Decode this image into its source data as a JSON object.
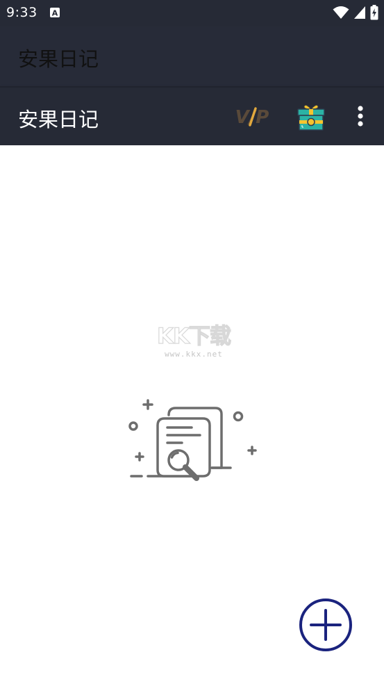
{
  "status_bar": {
    "time": "9:33",
    "notification_icon": "a-letter-icon",
    "icons": [
      "wifi-icon",
      "cell-signal-icon",
      "battery-charging-icon"
    ]
  },
  "title_bar": {
    "title": "安果日记"
  },
  "app_bar": {
    "title": "安果日记",
    "vip_label": "V/P",
    "vip_icon": "vip-icon",
    "gift_icon": "gift-box-icon",
    "menu_icon": "more-vert-icon"
  },
  "watermark": {
    "text": "KK下载",
    "url": "www.kkx.net"
  },
  "empty_state": {
    "icon": "document-search-icon"
  },
  "fab": {
    "icon": "plus-circle-icon"
  },
  "colors": {
    "status_bar_bg": "#262a36",
    "app_bar_bg": "#262a36",
    "fab_accent": "#1a237e",
    "gift_teal": "#2bb3a5",
    "gift_yellow": "#f6c42e",
    "vip_gold": "#e1a83e",
    "illustration_gray": "#6d6d6d"
  }
}
